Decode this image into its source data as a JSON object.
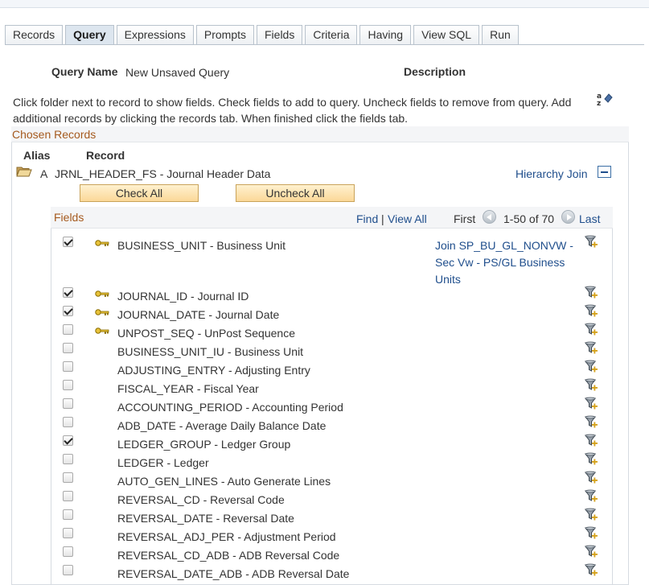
{
  "tabs": [
    {
      "label": "Records",
      "active": false
    },
    {
      "label": "Query",
      "active": true
    },
    {
      "label": "Expressions",
      "active": false
    },
    {
      "label": "Prompts",
      "active": false
    },
    {
      "label": "Fields",
      "active": false
    },
    {
      "label": "Criteria",
      "active": false
    },
    {
      "label": "Having",
      "active": false
    },
    {
      "label": "View SQL",
      "active": false
    },
    {
      "label": "Run",
      "active": false
    }
  ],
  "query": {
    "name_label": "Query Name",
    "name_value": "New Unsaved Query",
    "description_label": "Description",
    "instructions": "Click folder next to record to show fields. Check fields to add to query. Uncheck fields to remove from query. Add additional records by clicking the records tab. When finished click the fields tab."
  },
  "chosen_records": {
    "title": "Chosen Records",
    "alias_header": "Alias",
    "record_header": "Record",
    "record": {
      "alias": "A",
      "name": "JRNL_HEADER_FS - Journal Header Data",
      "hierarchy_join": "Hierarchy Join"
    },
    "check_all": "Check All",
    "uncheck_all": "Uncheck All"
  },
  "fields_grid": {
    "title": "Fields",
    "find": "Find",
    "separator": "|",
    "view_all": "View All",
    "first": "First",
    "range": "1-50 of 70",
    "last": "Last",
    "join_link": "Join SP_BU_GL_NONVW - Sec Vw - PS/GL Business Units",
    "rows": [
      {
        "label": "BUSINESS_UNIT - Business Unit",
        "checked": true,
        "key": true
      },
      {
        "label": "JOURNAL_ID - Journal ID",
        "checked": true,
        "key": true
      },
      {
        "label": "JOURNAL_DATE - Journal Date",
        "checked": true,
        "key": true
      },
      {
        "label": "UNPOST_SEQ - UnPost Sequence",
        "checked": false,
        "key": true
      },
      {
        "label": "BUSINESS_UNIT_IU - Business Unit",
        "checked": false,
        "key": false
      },
      {
        "label": "ADJUSTING_ENTRY - Adjusting Entry",
        "checked": false,
        "key": false
      },
      {
        "label": "FISCAL_YEAR - Fiscal Year",
        "checked": false,
        "key": false
      },
      {
        "label": "ACCOUNTING_PERIOD - Accounting Period",
        "checked": false,
        "key": false
      },
      {
        "label": "ADB_DATE - Average Daily Balance Date",
        "checked": false,
        "key": false
      },
      {
        "label": "LEDGER_GROUP - Ledger Group",
        "checked": true,
        "key": false
      },
      {
        "label": "LEDGER - Ledger",
        "checked": false,
        "key": false
      },
      {
        "label": "AUTO_GEN_LINES - Auto Generate Lines",
        "checked": false,
        "key": false
      },
      {
        "label": "REVERSAL_CD - Reversal Code",
        "checked": false,
        "key": false
      },
      {
        "label": "REVERSAL_DATE - Reversal Date",
        "checked": false,
        "key": false
      },
      {
        "label": "REVERSAL_ADJ_PER - Adjustment Period",
        "checked": false,
        "key": false
      },
      {
        "label": "REVERSAL_CD_ADB - ADB Reversal Code",
        "checked": false,
        "key": false
      },
      {
        "label": "REVERSAL_DATE_ADB - ADB Reversal Date",
        "checked": false,
        "key": false
      }
    ]
  },
  "colors": {
    "section_title": "#a55a1e",
    "link": "#1f4e8c",
    "button_fill": "#fbd898"
  },
  "icons": {
    "folder": "folder-open-icon",
    "key": "key-icon",
    "criteria": "add-criteria-funnel-icon",
    "sort": "sort-az-icon"
  }
}
